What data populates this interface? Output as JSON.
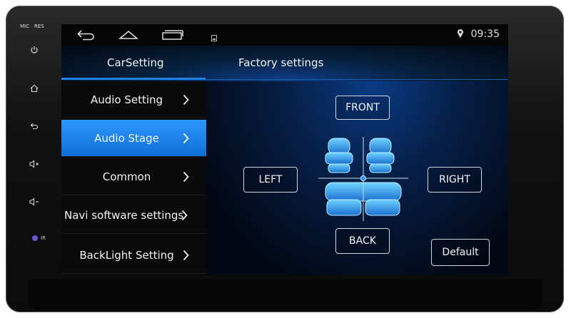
{
  "device": {
    "mic_label": "MIC",
    "res_label": "RES",
    "ir_label": "IR"
  },
  "statusbar": {
    "time": "09:35"
  },
  "tabs": [
    {
      "label": "CarSetting"
    },
    {
      "label": "Factory settings"
    }
  ],
  "menu": {
    "items": [
      {
        "label": "Audio Setting"
      },
      {
        "label": "Audio Stage"
      },
      {
        "label": "Common"
      },
      {
        "label": "Navi software settings"
      },
      {
        "label": "BackLight Setting"
      }
    ]
  },
  "stage": {
    "front_label": "FRONT",
    "back_label": "BACK",
    "left_label": "LEFT",
    "right_label": "RIGHT",
    "default_label": "Default"
  },
  "colors": {
    "accent": "#1e82e6",
    "active_item": "#1a85f0",
    "seat": "#39b6ff"
  }
}
